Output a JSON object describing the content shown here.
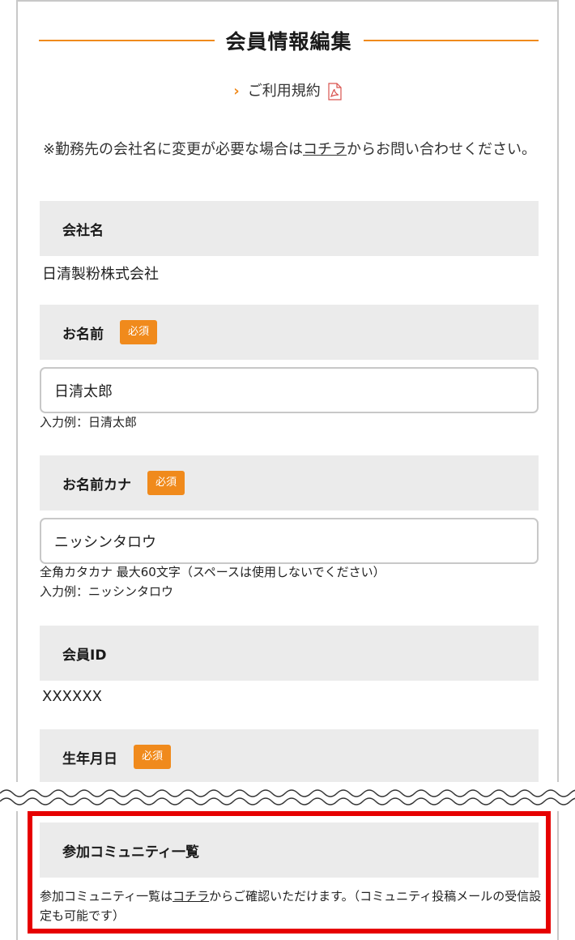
{
  "page": {
    "title": "会員情報編集",
    "terms_link": "ご利用規約",
    "notice": {
      "before": "※勤務先の会社名に変更が必要な場合は",
      "link": "コチラ",
      "after": "からお問い合わせください。"
    }
  },
  "fields": {
    "company": {
      "label": "会社名",
      "value": "日清製粉株式会社"
    },
    "name": {
      "label": "お名前",
      "required": "必須",
      "value": "日清太郎",
      "hint": "入力例：日清太郎"
    },
    "kana": {
      "label": "お名前カナ",
      "required": "必須",
      "value": "ニッシンタロウ",
      "hint1": "全角カタカナ 最大60文字（スペースは使用しないでください）",
      "hint2": "入力例：ニッシンタロウ"
    },
    "member_id": {
      "label": "会員ID",
      "value": "XXXXXX"
    },
    "birthday": {
      "label": "生年月日",
      "required": "必須"
    }
  },
  "community": {
    "label": "参加コミュニティ一覧",
    "text_before": "参加コミュニティ一覧は",
    "link": "コチラ",
    "text_after": "からご確認いただけます。（コミュニティ投稿メールの受信設定も可能です）"
  },
  "colors": {
    "accent": "#f08a1c",
    "highlight": "#e60000",
    "section_bg": "#ebebeb"
  },
  "icons": {
    "terms": "chevron-right-icon",
    "pdf": "pdf-icon"
  }
}
